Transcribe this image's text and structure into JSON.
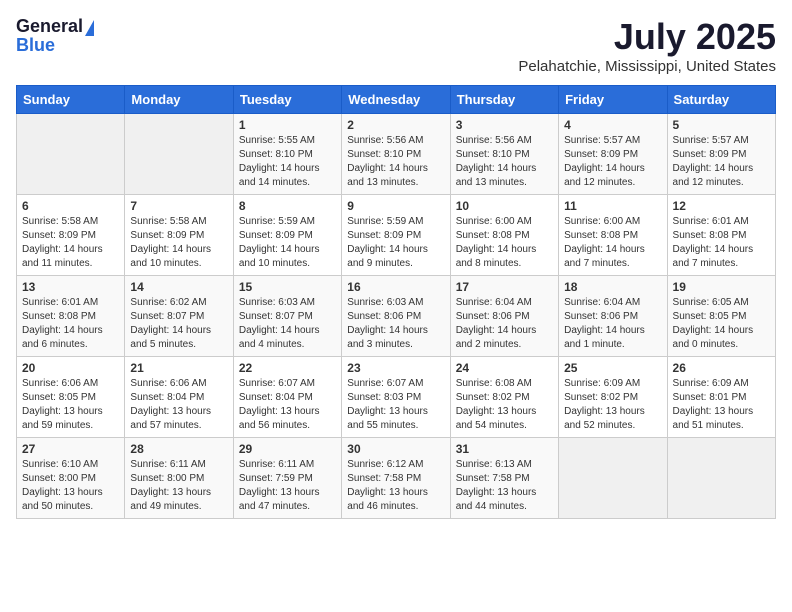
{
  "logo": {
    "general": "General",
    "blue": "Blue"
  },
  "title": {
    "month_year": "July 2025",
    "location": "Pelahatchie, Mississippi, United States"
  },
  "days_of_week": [
    "Sunday",
    "Monday",
    "Tuesday",
    "Wednesday",
    "Thursday",
    "Friday",
    "Saturday"
  ],
  "weeks": [
    [
      {
        "day": "",
        "sunrise": "",
        "sunset": "",
        "daylight": ""
      },
      {
        "day": "",
        "sunrise": "",
        "sunset": "",
        "daylight": ""
      },
      {
        "day": "1",
        "sunrise": "Sunrise: 5:55 AM",
        "sunset": "Sunset: 8:10 PM",
        "daylight": "Daylight: 14 hours and 14 minutes."
      },
      {
        "day": "2",
        "sunrise": "Sunrise: 5:56 AM",
        "sunset": "Sunset: 8:10 PM",
        "daylight": "Daylight: 14 hours and 13 minutes."
      },
      {
        "day": "3",
        "sunrise": "Sunrise: 5:56 AM",
        "sunset": "Sunset: 8:10 PM",
        "daylight": "Daylight: 14 hours and 13 minutes."
      },
      {
        "day": "4",
        "sunrise": "Sunrise: 5:57 AM",
        "sunset": "Sunset: 8:09 PM",
        "daylight": "Daylight: 14 hours and 12 minutes."
      },
      {
        "day": "5",
        "sunrise": "Sunrise: 5:57 AM",
        "sunset": "Sunset: 8:09 PM",
        "daylight": "Daylight: 14 hours and 12 minutes."
      }
    ],
    [
      {
        "day": "6",
        "sunrise": "Sunrise: 5:58 AM",
        "sunset": "Sunset: 8:09 PM",
        "daylight": "Daylight: 14 hours and 11 minutes."
      },
      {
        "day": "7",
        "sunrise": "Sunrise: 5:58 AM",
        "sunset": "Sunset: 8:09 PM",
        "daylight": "Daylight: 14 hours and 10 minutes."
      },
      {
        "day": "8",
        "sunrise": "Sunrise: 5:59 AM",
        "sunset": "Sunset: 8:09 PM",
        "daylight": "Daylight: 14 hours and 10 minutes."
      },
      {
        "day": "9",
        "sunrise": "Sunrise: 5:59 AM",
        "sunset": "Sunset: 8:09 PM",
        "daylight": "Daylight: 14 hours and 9 minutes."
      },
      {
        "day": "10",
        "sunrise": "Sunrise: 6:00 AM",
        "sunset": "Sunset: 8:08 PM",
        "daylight": "Daylight: 14 hours and 8 minutes."
      },
      {
        "day": "11",
        "sunrise": "Sunrise: 6:00 AM",
        "sunset": "Sunset: 8:08 PM",
        "daylight": "Daylight: 14 hours and 7 minutes."
      },
      {
        "day": "12",
        "sunrise": "Sunrise: 6:01 AM",
        "sunset": "Sunset: 8:08 PM",
        "daylight": "Daylight: 14 hours and 7 minutes."
      }
    ],
    [
      {
        "day": "13",
        "sunrise": "Sunrise: 6:01 AM",
        "sunset": "Sunset: 8:08 PM",
        "daylight": "Daylight: 14 hours and 6 minutes."
      },
      {
        "day": "14",
        "sunrise": "Sunrise: 6:02 AM",
        "sunset": "Sunset: 8:07 PM",
        "daylight": "Daylight: 14 hours and 5 minutes."
      },
      {
        "day": "15",
        "sunrise": "Sunrise: 6:03 AM",
        "sunset": "Sunset: 8:07 PM",
        "daylight": "Daylight: 14 hours and 4 minutes."
      },
      {
        "day": "16",
        "sunrise": "Sunrise: 6:03 AM",
        "sunset": "Sunset: 8:06 PM",
        "daylight": "Daylight: 14 hours and 3 minutes."
      },
      {
        "day": "17",
        "sunrise": "Sunrise: 6:04 AM",
        "sunset": "Sunset: 8:06 PM",
        "daylight": "Daylight: 14 hours and 2 minutes."
      },
      {
        "day": "18",
        "sunrise": "Sunrise: 6:04 AM",
        "sunset": "Sunset: 8:06 PM",
        "daylight": "Daylight: 14 hours and 1 minute."
      },
      {
        "day": "19",
        "sunrise": "Sunrise: 6:05 AM",
        "sunset": "Sunset: 8:05 PM",
        "daylight": "Daylight: 14 hours and 0 minutes."
      }
    ],
    [
      {
        "day": "20",
        "sunrise": "Sunrise: 6:06 AM",
        "sunset": "Sunset: 8:05 PM",
        "daylight": "Daylight: 13 hours and 59 minutes."
      },
      {
        "day": "21",
        "sunrise": "Sunrise: 6:06 AM",
        "sunset": "Sunset: 8:04 PM",
        "daylight": "Daylight: 13 hours and 57 minutes."
      },
      {
        "day": "22",
        "sunrise": "Sunrise: 6:07 AM",
        "sunset": "Sunset: 8:04 PM",
        "daylight": "Daylight: 13 hours and 56 minutes."
      },
      {
        "day": "23",
        "sunrise": "Sunrise: 6:07 AM",
        "sunset": "Sunset: 8:03 PM",
        "daylight": "Daylight: 13 hours and 55 minutes."
      },
      {
        "day": "24",
        "sunrise": "Sunrise: 6:08 AM",
        "sunset": "Sunset: 8:02 PM",
        "daylight": "Daylight: 13 hours and 54 minutes."
      },
      {
        "day": "25",
        "sunrise": "Sunrise: 6:09 AM",
        "sunset": "Sunset: 8:02 PM",
        "daylight": "Daylight: 13 hours and 52 minutes."
      },
      {
        "day": "26",
        "sunrise": "Sunrise: 6:09 AM",
        "sunset": "Sunset: 8:01 PM",
        "daylight": "Daylight: 13 hours and 51 minutes."
      }
    ],
    [
      {
        "day": "27",
        "sunrise": "Sunrise: 6:10 AM",
        "sunset": "Sunset: 8:00 PM",
        "daylight": "Daylight: 13 hours and 50 minutes."
      },
      {
        "day": "28",
        "sunrise": "Sunrise: 6:11 AM",
        "sunset": "Sunset: 8:00 PM",
        "daylight": "Daylight: 13 hours and 49 minutes."
      },
      {
        "day": "29",
        "sunrise": "Sunrise: 6:11 AM",
        "sunset": "Sunset: 7:59 PM",
        "daylight": "Daylight: 13 hours and 47 minutes."
      },
      {
        "day": "30",
        "sunrise": "Sunrise: 6:12 AM",
        "sunset": "Sunset: 7:58 PM",
        "daylight": "Daylight: 13 hours and 46 minutes."
      },
      {
        "day": "31",
        "sunrise": "Sunrise: 6:13 AM",
        "sunset": "Sunset: 7:58 PM",
        "daylight": "Daylight: 13 hours and 44 minutes."
      },
      {
        "day": "",
        "sunrise": "",
        "sunset": "",
        "daylight": ""
      },
      {
        "day": "",
        "sunrise": "",
        "sunset": "",
        "daylight": ""
      }
    ]
  ]
}
